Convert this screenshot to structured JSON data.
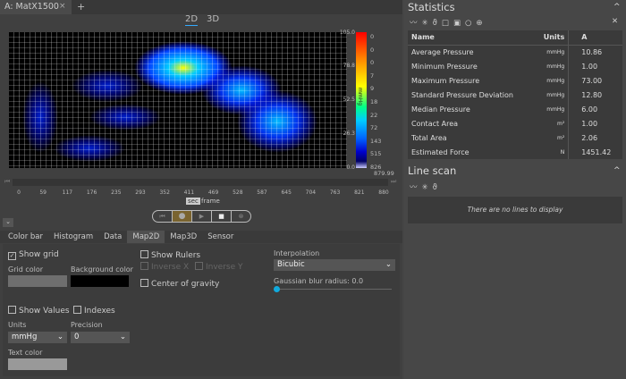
{
  "tab": {
    "title": "A: MatX1500",
    "close": "×",
    "add": "+"
  },
  "view": {
    "tab2d": "2D",
    "tab3d": "3D"
  },
  "colorbar": {
    "unit": "mmHg",
    "labels": [
      "105.0",
      "78.8",
      "52.5",
      "26.3",
      "0.0"
    ],
    "counts": [
      "0",
      "0",
      "0",
      "7",
      "9",
      "18",
      "22",
      "72",
      "143",
      "515",
      "826"
    ],
    "total": "879.99"
  },
  "timeline": {
    "ticks": [
      "0",
      "59",
      "117",
      "176",
      "235",
      "293",
      "352",
      "411",
      "469",
      "528",
      "587",
      "645",
      "704",
      "763",
      "821",
      "880"
    ],
    "sec": "sec",
    "frame": "frame"
  },
  "tabs": [
    "Color bar",
    "Histogram",
    "Data",
    "Map2D",
    "Map3D",
    "Sensor"
  ],
  "map2d": {
    "show_grid": "Show grid",
    "show_grid_checked": true,
    "grid_color": "Grid color",
    "grid_color_value": "#6e6e6e",
    "background_color": "Background color",
    "background_color_value": "#000000",
    "show_rulers": "Show Rulers",
    "inverse_x": "Inverse X",
    "inverse_y": "Inverse Y",
    "center_of_gravity": "Center of gravity",
    "interpolation": "Interpolation",
    "interpolation_value": "Bicubic",
    "blur": "Gaussian blur radius: 0.0",
    "blur_value": 0,
    "show_values": "Show Values",
    "indexes": "Indexes",
    "units": "Units",
    "units_value": "mmHg",
    "precision": "Precision",
    "precision_value": "0",
    "text_color": "Text color",
    "text_color_value": "#999999"
  },
  "statistics": {
    "title": "Statistics",
    "headers": [
      "Name",
      "Units",
      "A"
    ],
    "rows": [
      [
        "Average Pressure",
        "mmHg",
        "10.86"
      ],
      [
        "Minimum Pressure",
        "mmHg",
        "1.00"
      ],
      [
        "Maximum Pressure",
        "mmHg",
        "73.00"
      ],
      [
        "Standard Pressure Deviation",
        "mmHg",
        "12.80"
      ],
      [
        "Median Pressure",
        "mmHg",
        "6.00"
      ],
      [
        "Contact Area",
        "m²",
        "1.00"
      ],
      [
        "Total Area",
        "m²",
        "2.06"
      ],
      [
        "Estimated Force",
        "N",
        "1451.42"
      ]
    ]
  },
  "linescan": {
    "title": "Line scan",
    "empty": "There are no lines to display"
  }
}
